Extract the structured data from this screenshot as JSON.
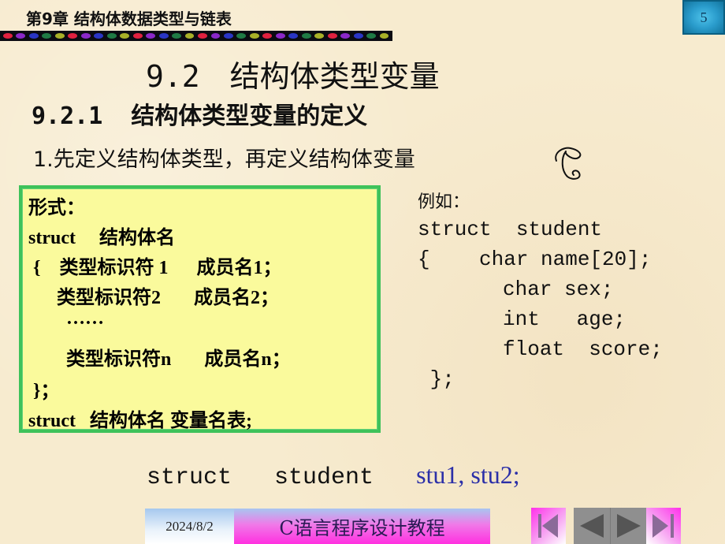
{
  "header": {
    "chapter_title": "第9章  结构体数据类型与链表",
    "page_number": "5",
    "dot_colors": [
      "#e0213f",
      "#8a28c8",
      "#2a35c4",
      "#1f7a45",
      "#a8b028"
    ]
  },
  "content": {
    "section_number": "9.2",
    "section_title": "结构体类型变量",
    "subsection_number": "9.2.1",
    "subsection_title": "结构体类型变量的定义",
    "step_title": "1.先定义结构体类型，再定义结构体变量",
    "form_box": {
      "lines": [
        "形式：",
        "struct     结构体名",
        " {    类型标识符 1      成员名1；",
        "      类型标识符2       成员名2；",
        "        ……",
        "        类型标识符n       成员名n；",
        " }；",
        "struct   结构体名 变量名表;"
      ]
    },
    "example": {
      "label": "例如：",
      "lines": [
        "struct  student",
        "{    char name[20];",
        "     char sex;",
        "     int   age;",
        "     float  score;",
        " };"
      ]
    },
    "declaration": {
      "prefix": "struct   student   ",
      "variables": "stu1, stu2;"
    }
  },
  "footer": {
    "date": "2024/8/2",
    "course_title": "C语言程序设计教程",
    "nav": {
      "first_label": "first-slide",
      "prev_label": "previous-slide",
      "next_label": "next-slide",
      "last_label": "last-slide"
    }
  }
}
